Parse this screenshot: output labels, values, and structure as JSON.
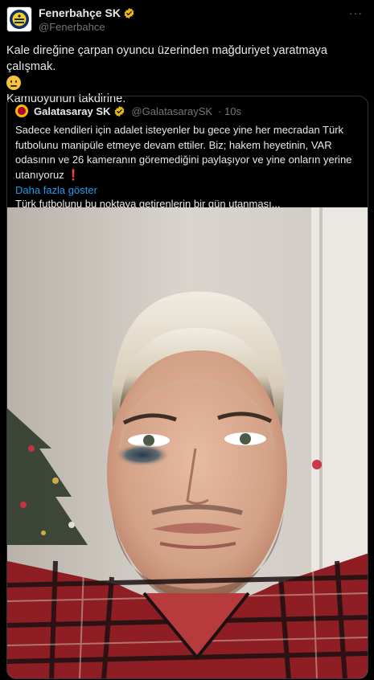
{
  "tweet": {
    "author_name": "Fenerbahçe SK",
    "author_handle": "@Fenerbahce",
    "more_label": "···",
    "text_line1": "Kale direğine çarpan oyuncu üzerinden mağduriyet yaratmaya çalışmak.",
    "text_line2": "Kamuoyunun takdirine.",
    "emoji": "🫢",
    "avatar_icon": "fenerbahce-crest-icon",
    "verified_color": "#e2b719"
  },
  "quote": {
    "author_name": "Galatasaray SK",
    "author_handle": "@GalatasaraySK",
    "time": "· 10s",
    "para1": "Sadece kendileri için adalet isteyenler bu gece yine her mecradan Türk futbolunu manipüle etmeye devam ettiler. Biz; hakem heyetinin, VAR odasının ve 26 kameranın göremediğini paylaşıyor ve yine onların yerine utanıyoruz",
    "para1_emoji": "❗",
    "para2": "Türk futbolunu bu noktaya getirenlerin bir gün utanması...",
    "show_more": "Daha fazla göster",
    "link_color": "#1d9bf0",
    "avatar_icon": "galatasaray-crest-icon"
  }
}
